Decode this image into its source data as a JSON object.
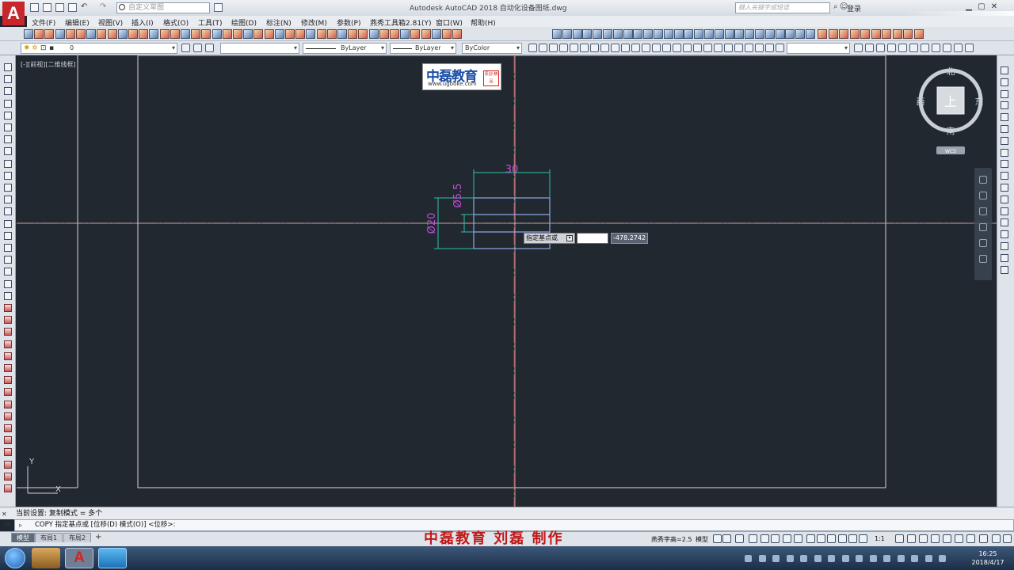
{
  "window": {
    "title": "Autodesk AutoCAD 2018    自动化设备图纸.dwg",
    "workspace": "自定义草图",
    "search_placeholder": "键入关键字或短语",
    "login": "登录"
  },
  "menubar": {
    "items": [
      "文件(F)",
      "编辑(E)",
      "视图(V)",
      "插入(I)",
      "格式(O)",
      "工具(T)",
      "绘图(D)",
      "标注(N)",
      "修改(M)",
      "参数(P)",
      "燕秀工具箱2.81(Y)",
      "窗口(W)",
      "帮助(H)"
    ]
  },
  "properties": {
    "layer": "0",
    "linetype": "ByLayer",
    "lineweight": "ByLayer",
    "color": "ByColor"
  },
  "viewport": {
    "label": "[-][前视][二维线框]"
  },
  "viewcube": {
    "north": "北",
    "south": "南",
    "east": "东",
    "west": "西",
    "face": "上",
    "wcs": "WCS"
  },
  "watermark": {
    "main": "中磊教育",
    "url": "www.ugboke.com",
    "seal": "原创 精品"
  },
  "drawing": {
    "dim_top": "30",
    "dim_inner": "Ø5.5",
    "dim_outer": "Ø20",
    "ucs_y": "Y",
    "ucs_x": "X"
  },
  "dynamic_input": {
    "prompt": "指定基点或",
    "value": "",
    "coordinate": "-478.2742"
  },
  "command": {
    "history": "当前设置:  复制模式 = 多个",
    "line": "COPY 指定基点或 [位移(D) 模式(O)] <位移>:"
  },
  "layout_tabs": [
    "模型",
    "布局1",
    "布局2"
  ],
  "status": {
    "credit": "中磊教育  刘磊  制作",
    "text_height": "燕秀字高=2.5",
    "mode": "模型",
    "scale": "1:1"
  },
  "taskbar": {
    "time": "16:25",
    "date": "2018/4/17"
  },
  "colors": {
    "canvas": "#212830",
    "geometry": "#8fa8e6",
    "dimension": "#2fc2a8",
    "dim_text": "#c04fd8",
    "center_red": "#c23a3a",
    "crosshair": "#dcdcdc"
  }
}
